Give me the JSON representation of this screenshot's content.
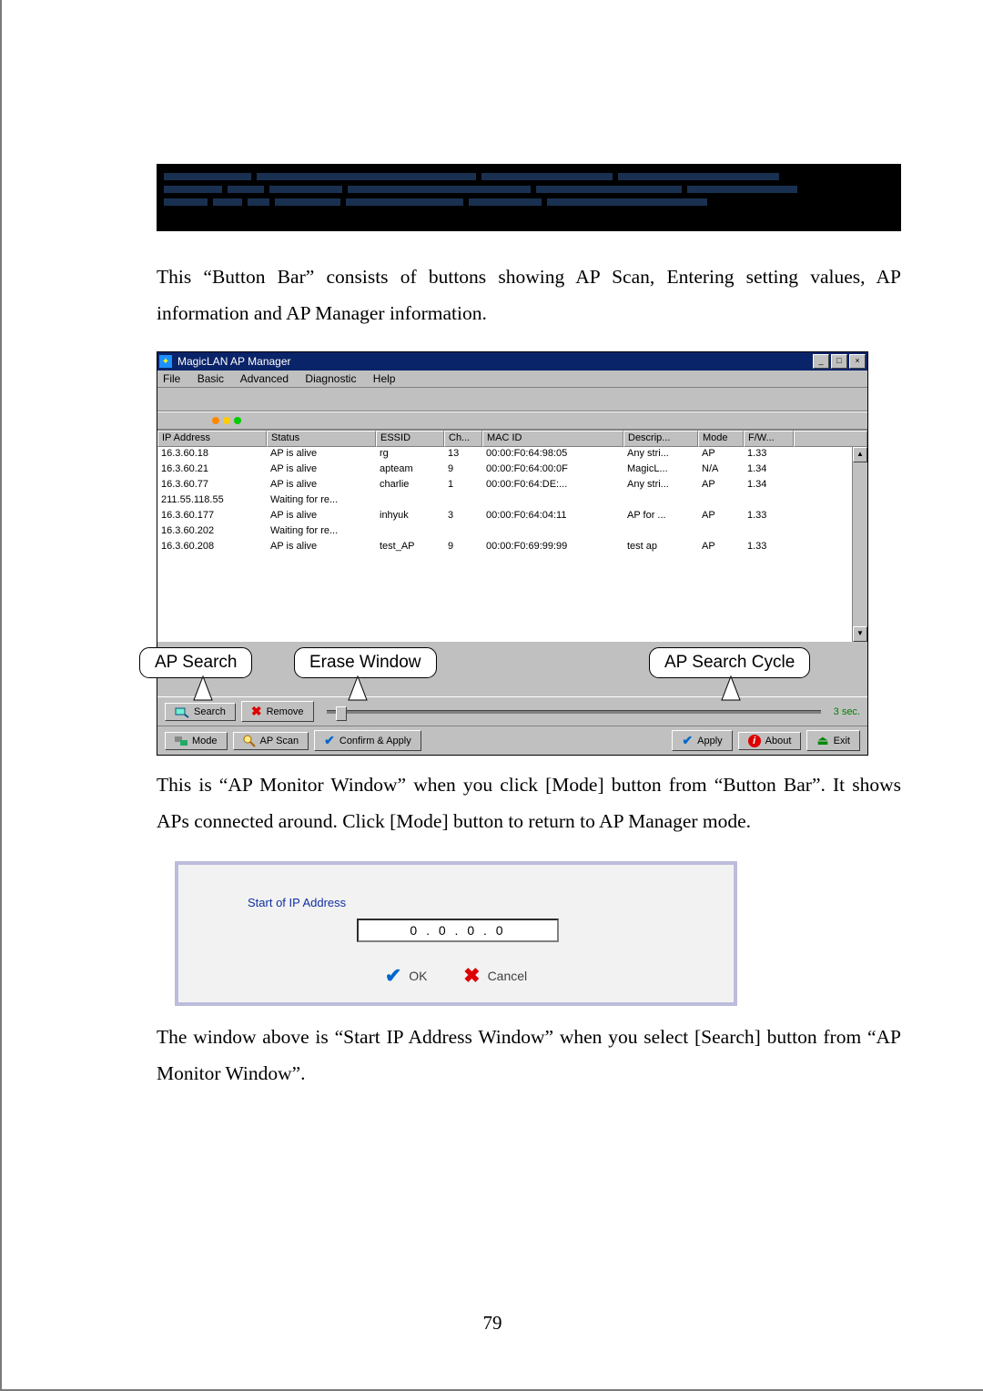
{
  "page_number": "79",
  "paragraph1": "This “Button Bar” consists of buttons showing AP Scan, Entering setting values, AP information and AP Manager information.",
  "paragraph2": "This is “AP Monitor Window” when you click [Mode] button from “Button Bar”. It shows APs connected around. Click [Mode] button to return to AP Manager mode.",
  "paragraph3": "The window above is “Start IP Address Window” when you select [Search] button from “AP Monitor Window”.",
  "win": {
    "title": "MagicLAN AP Manager",
    "menu": {
      "file": "File",
      "basic": "Basic",
      "advanced": "Advanced",
      "diagnostic": "Diagnostic",
      "help": "Help"
    },
    "headers": {
      "ip": "IP Address",
      "status": "Status",
      "essid": "ESSID",
      "ch": "Ch...",
      "mac": "MAC ID",
      "desc": "Descrip...",
      "mode": "Mode",
      "fw": "F/W..."
    },
    "rows": [
      {
        "ip": "16.3.60.18",
        "st": "AP is alive",
        "es": "rg",
        "ch": "13",
        "mac": "00:00:F0:64:98:05",
        "de": "Any stri...",
        "mo": "AP",
        "fw": "1.33"
      },
      {
        "ip": "16.3.60.21",
        "st": "AP is alive",
        "es": "apteam",
        "ch": "9",
        "mac": "00:00:F0:64:00:0F",
        "de": "MagicL...",
        "mo": "N/A",
        "fw": "1.34"
      },
      {
        "ip": "16.3.60.77",
        "st": "AP is alive",
        "es": "charlie",
        "ch": "1",
        "mac": "00:00:F0:64:DE:...",
        "de": "Any stri...",
        "mo": "AP",
        "fw": "1.34"
      },
      {
        "ip": "211.55.118.55",
        "st": "Waiting for re...",
        "es": "",
        "ch": "",
        "mac": "",
        "de": "",
        "mo": "",
        "fw": ""
      },
      {
        "ip": "16.3.60.177",
        "st": "AP is alive",
        "es": "inhyuk",
        "ch": "3",
        "mac": "00:00:F0:64:04:11",
        "de": "AP for ...",
        "mo": "AP",
        "fw": "1.33"
      },
      {
        "ip": "16.3.60.202",
        "st": "Waiting for re...",
        "es": "",
        "ch": "",
        "mac": "",
        "de": "",
        "mo": "",
        "fw": ""
      },
      {
        "ip": "16.3.60.208",
        "st": "AP is alive",
        "es": "test_AP",
        "ch": "9",
        "mac": "00:00:F0:69:99:99",
        "de": "test ap",
        "mo": "AP",
        "fw": "1.33"
      }
    ],
    "callouts": {
      "search": "AP Search",
      "erase": "Erase Window",
      "cycle": "AP Search Cycle"
    },
    "toolbar": {
      "search": "Search",
      "remove": "Remove",
      "sec": "3 sec."
    },
    "bottom": {
      "mode": "Mode",
      "apscan": "AP Scan",
      "confirm": "Confirm & Apply",
      "apply": "Apply",
      "about": "About",
      "exit": "Exit"
    }
  },
  "dlg": {
    "label": "Start of IP Address",
    "ip": "0   .   0   .   0   .   0",
    "ok": "OK",
    "cancel": "Cancel"
  }
}
